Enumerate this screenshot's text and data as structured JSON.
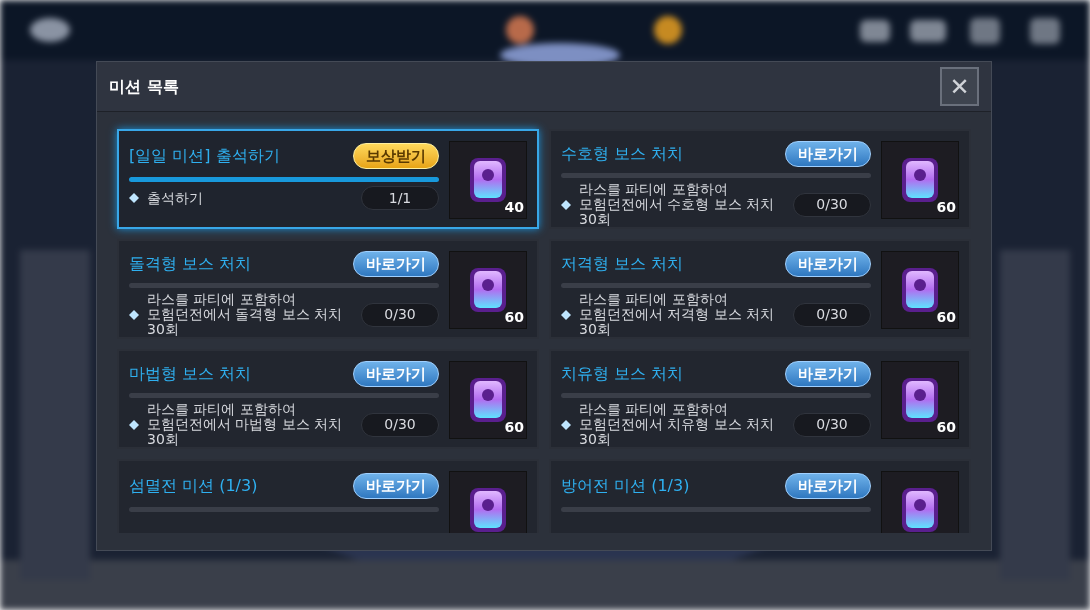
{
  "dialog": {
    "title": "미션 목록",
    "close_label": "✕"
  },
  "missions": [
    {
      "title": "[일일 미션] 출석하기",
      "selected": true,
      "button": {
        "kind": "claim",
        "label": "보상받기"
      },
      "completed": true,
      "description": "출석하기",
      "progress": "1/1",
      "reward": "40"
    },
    {
      "title": "수호형 보스 처치",
      "selected": false,
      "button": {
        "kind": "go",
        "label": "바로가기"
      },
      "completed": false,
      "description": "라스를 파티에 포함하여\n모험던전에서 수호형 보스 처치\n30회",
      "progress": "0/30",
      "reward": "60"
    },
    {
      "title": "돌격형 보스 처치",
      "selected": false,
      "button": {
        "kind": "go",
        "label": "바로가기"
      },
      "completed": false,
      "description": "라스를 파티에 포함하여\n모험던전에서 돌격형 보스 처치\n30회",
      "progress": "0/30",
      "reward": "60"
    },
    {
      "title": "저격형 보스 처치",
      "selected": false,
      "button": {
        "kind": "go",
        "label": "바로가기"
      },
      "completed": false,
      "description": "라스를 파티에 포함하여\n모험던전에서 저격형 보스 처치\n30회",
      "progress": "0/30",
      "reward": "60"
    },
    {
      "title": "마법형 보스 처치",
      "selected": false,
      "button": {
        "kind": "go",
        "label": "바로가기"
      },
      "completed": false,
      "description": "라스를 파티에 포함하여\n모험던전에서 마법형 보스 처치\n30회",
      "progress": "0/30",
      "reward": "60"
    },
    {
      "title": "치유형 보스 처치",
      "selected": false,
      "button": {
        "kind": "go",
        "label": "바로가기"
      },
      "completed": false,
      "description": "라스를 파티에 포함하여\n모험던전에서 치유형 보스 처치\n30회",
      "progress": "0/30",
      "reward": "60"
    },
    {
      "title": "섬멸전 미션 (1/3)",
      "selected": false,
      "button": {
        "kind": "go",
        "label": "바로가기"
      },
      "completed": false
    },
    {
      "title": "방어전 미션 (1/3)",
      "selected": false,
      "button": {
        "kind": "go",
        "label": "바로가기"
      },
      "completed": false
    }
  ]
}
